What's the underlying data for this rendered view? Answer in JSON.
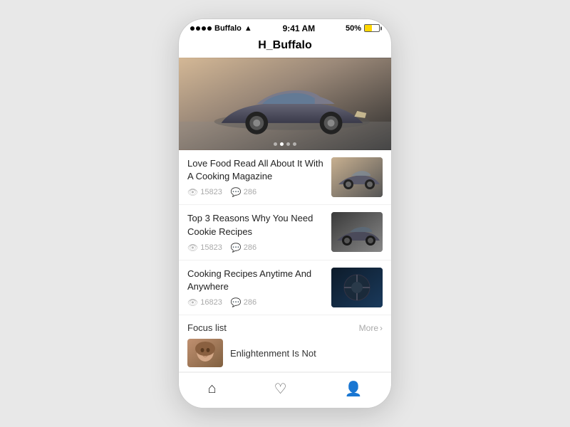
{
  "statusBar": {
    "carrier": "Buffalo",
    "time": "9:41 AM",
    "battery": "50%"
  },
  "appTitle": "H_Buffalo",
  "hero": {
    "dots": [
      false,
      true,
      false,
      false
    ]
  },
  "articles": [
    {
      "title": "Love Food Read All About It With A Cooking Magazine",
      "views": "15823",
      "comments": "286",
      "thumbType": "car1"
    },
    {
      "title": "Top 3 Reasons Why You Need Cookie Recipes",
      "views": "15823",
      "comments": "286",
      "thumbType": "car2"
    },
    {
      "title": "Cooking Recipes Anytime And Anywhere",
      "views": "16823",
      "comments": "286",
      "thumbType": "interior"
    }
  ],
  "focusSection": {
    "label": "Focus list",
    "moreLabel": "More",
    "item": {
      "title": "Enlightenment Is Not",
      "thumbType": "face"
    }
  },
  "bottomNav": {
    "items": [
      {
        "icon": "🏠",
        "label": "home",
        "active": true
      },
      {
        "icon": "♡",
        "label": "favorites",
        "active": false
      },
      {
        "icon": "👤",
        "label": "profile",
        "active": false
      }
    ]
  }
}
